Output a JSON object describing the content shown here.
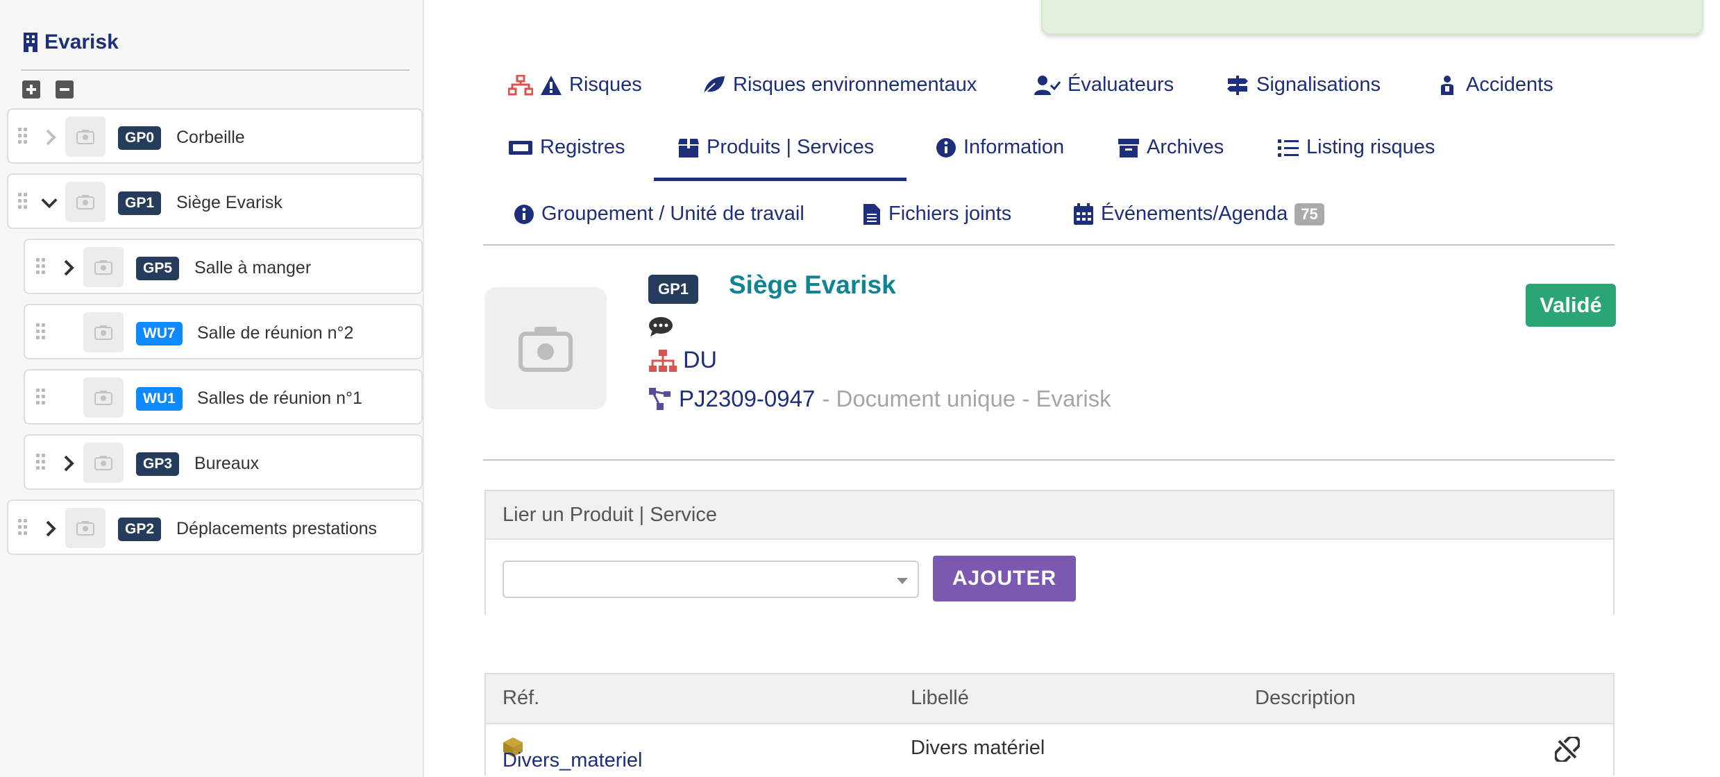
{
  "tree": {
    "title": "Evarisk",
    "nodes": [
      {
        "ref": "GP0",
        "label": "Corbeille"
      },
      {
        "ref": "GP1",
        "label": "Siège Evarisk"
      },
      {
        "ref": "GP5",
        "label": "Salle à manger"
      },
      {
        "ref": "WU7",
        "label": "Salle de réunion n°2"
      },
      {
        "ref": "WU1",
        "label": "Salles de réunion n°1"
      },
      {
        "ref": "GP3",
        "label": "Bureaux"
      },
      {
        "ref": "GP2",
        "label": "Déplacements prestations"
      }
    ]
  },
  "tabs": {
    "risks": "Risques",
    "env_risks": "Risques environnementaux",
    "evaluators": "Évaluateurs",
    "signals": "Signalisations",
    "accidents": "Accidents",
    "registers": "Registres",
    "products": "Produits | Services",
    "information": "Information",
    "archives": "Archives",
    "risk_listing": "Listing risques",
    "group_unit": "Groupement / Unité de travail",
    "attachments": "Fichiers joints",
    "events": "Événements/Agenda",
    "events_count": "75"
  },
  "banner": {
    "ref": "GP1",
    "name": "Siège Evarisk",
    "du": "DU",
    "project_ref": "PJ2309-0947",
    "project_desc": " - Document unique - Evarisk",
    "status": "Validé"
  },
  "link_panel": {
    "title": "Lier un Produit | Service",
    "select_value": "",
    "add_label": "AJOUTER"
  },
  "table": {
    "headers": [
      "Réf.",
      "Libellé",
      "Description"
    ],
    "rows": [
      {
        "ref": "Divers_materiel",
        "label": "Divers matériel",
        "description": ""
      }
    ]
  },
  "colors": {
    "navy": "#1d2e7a",
    "gp_badge": "#263c5c",
    "wu_badge": "#0d8aff",
    "status_green": "#2aa574",
    "add_button": "#7b59b1",
    "teal_title": "#118494"
  }
}
